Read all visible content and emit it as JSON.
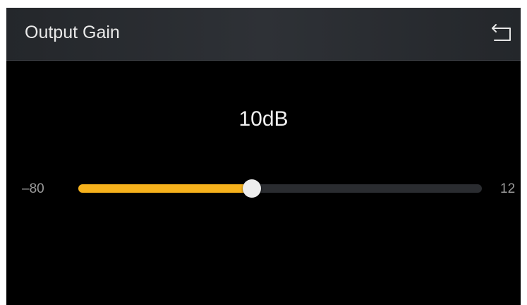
{
  "header": {
    "title": "Output Gain",
    "back_icon": "back-arrow-icon"
  },
  "gain": {
    "display": "10dB",
    "value_db": 10,
    "min_label": "–80",
    "max_label": "12",
    "min": -80,
    "max": 12,
    "slider_fraction": 0.43
  },
  "colors": {
    "background": "#000000",
    "header_background": "#2a2d31",
    "accent": "#f7b21c",
    "track": "#2a2c30",
    "thumb": "#ededed"
  }
}
